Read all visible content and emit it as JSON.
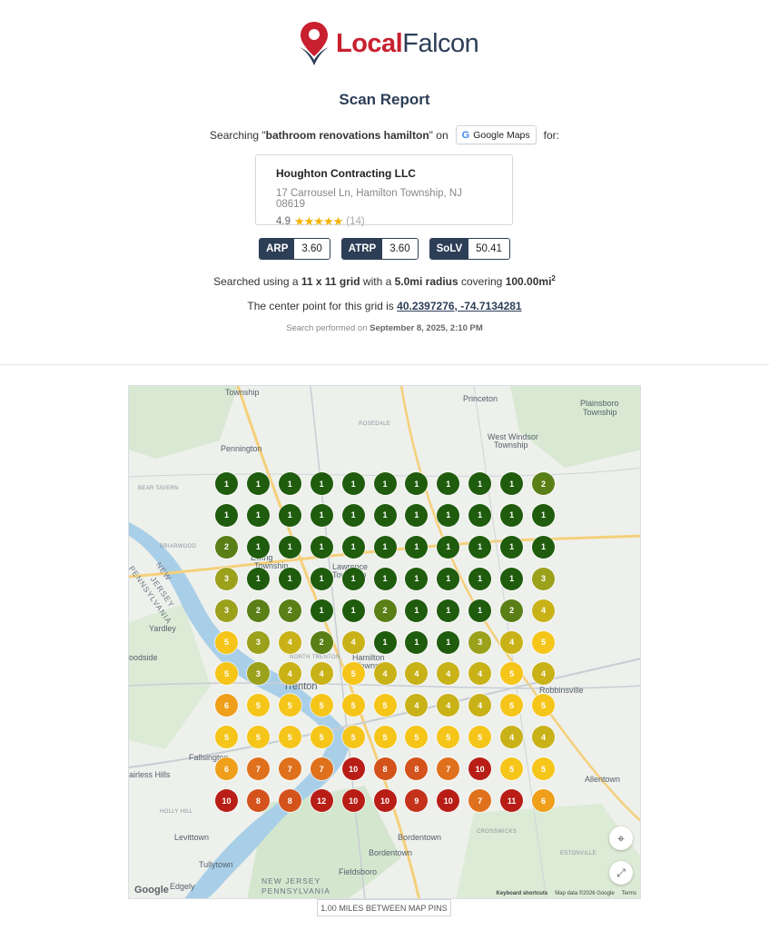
{
  "brand": {
    "local": "Local",
    "falcon": "Falcon"
  },
  "report": {
    "title": "Scan Report",
    "searching_prefix": "Searching \"",
    "keyword": "bathroom renovations hamilton",
    "searching_on": "\" on",
    "platform": "Google Maps",
    "for": "for:"
  },
  "business": {
    "name": "Houghton Contracting LLC",
    "address": "17 Carrousel Ln, Hamilton Township, NJ 08619",
    "rating": "4.9",
    "stars": "★★★★★",
    "reviews": "(14)"
  },
  "metrics": [
    {
      "key": "ARP",
      "value": "3.60"
    },
    {
      "key": "ATRP",
      "value": "3.60"
    },
    {
      "key": "SoLV",
      "value": "50.41"
    }
  ],
  "grid_info": {
    "prefix": "Searched using a",
    "grid": "11 x 11 grid",
    "mid": "with a",
    "radius": "5.0mi radius",
    "covering": "covering",
    "area": "100.00mi",
    "area_sup": "2"
  },
  "center": {
    "prefix": "The center point for this grid is",
    "coords": "40.2397276, -74.7134281"
  },
  "performed": {
    "prefix": "Search performed on",
    "date": "September 8, 2025, 2:10 PM"
  },
  "map": {
    "places": {
      "township": "Township",
      "princeton": "Princeton",
      "rosedale": "ROSEDALE",
      "pennington": "Pennington",
      "west_windsor": "West Windsor",
      "west_windsor2": "Township",
      "plainsboro": "Plainsboro",
      "plainsboro2": "Township",
      "bear_tavern": "BEAR TAVERN",
      "briarwood": "BRIARWOOD",
      "pennsylvania": "PENNSYLVANIA",
      "new_jersey": "NEW",
      "new_jersey2": "JERSEY",
      "ewing": "Ewing",
      "ewing2": "Township",
      "lawrence": "Lawrence",
      "lawrence2": "Township",
      "yardley": "Yardley",
      "woodside": "oodside",
      "north_trenton": "NORTH TRENTON",
      "hamilton": "Hamilton",
      "hamilton2": "Township",
      "trenton": "Trenton",
      "robbinsville": "Robbinsville",
      "fallsington": "Fallsington",
      "fairless": "airless Hills",
      "allentown": "Allentown",
      "holly": "HOLLY HILL",
      "levittown": "Levittown",
      "crosswicks": "CROSSWICKS",
      "bordentown": "Bordentown",
      "bordentown2": "Bordentown",
      "estonville": "ESTONVILLE",
      "tullytown": "Tullytown",
      "edgely": "Edgely",
      "fieldsboro": "Fieldsboro",
      "new_jersey3": "NEW JERSEY",
      "pennsylvania2": "PENNSYLVANIA"
    },
    "ranks": [
      [
        "1",
        "1",
        "1",
        "1",
        "1",
        "1",
        "1",
        "1",
        "1",
        "1",
        "2"
      ],
      [
        "1",
        "1",
        "1",
        "1",
        "1",
        "1",
        "1",
        "1",
        "1",
        "1",
        "1"
      ],
      [
        "2",
        "1",
        "1",
        "1",
        "1",
        "1",
        "1",
        "1",
        "1",
        "1",
        "1"
      ],
      [
        "3",
        "1",
        "1",
        "1",
        "1",
        "1",
        "1",
        "1",
        "1",
        "1",
        "3"
      ],
      [
        "3",
        "2",
        "2",
        "1",
        "1",
        "2",
        "1",
        "1",
        "1",
        "2",
        "4"
      ],
      [
        "5",
        "3",
        "4",
        "2",
        "4",
        "1",
        "1",
        "1",
        "3",
        "4",
        "5"
      ],
      [
        "5",
        "3",
        "4",
        "4",
        "5",
        "4",
        "4",
        "4",
        "4",
        "5",
        "4"
      ],
      [
        "6",
        "5",
        "5",
        "5",
        "5",
        "5",
        "4",
        "4",
        "4",
        "5",
        "5"
      ],
      [
        "5",
        "5",
        "5",
        "5",
        "5",
        "5",
        "5",
        "5",
        "5",
        "4",
        "4"
      ],
      [
        "6",
        "7",
        "7",
        "7",
        "10",
        "8",
        "8",
        "7",
        "10",
        "5",
        "5"
      ],
      [
        "10",
        "8",
        "8",
        "12",
        "10",
        "10",
        "9",
        "10",
        "7",
        "11",
        "6"
      ]
    ],
    "colors": {
      "1": "#1f5c0d",
      "2": "#5a7f17",
      "3": "#9ba11b",
      "4": "#c9b218",
      "5": "#f5c519",
      "6": "#ef9f1a",
      "7": "#e0711c",
      "8": "#d4521b",
      "9": "#c4321a",
      "10": "#b81d16",
      "11": "#b81d16",
      "12": "#b81d16"
    },
    "keyboard": "Keyboard shortcuts",
    "map_data": "Map data ©2026 Google",
    "terms": "Terms",
    "google": "Google"
  },
  "miles_label": "1.00 MILES BETWEEN MAP PINS"
}
